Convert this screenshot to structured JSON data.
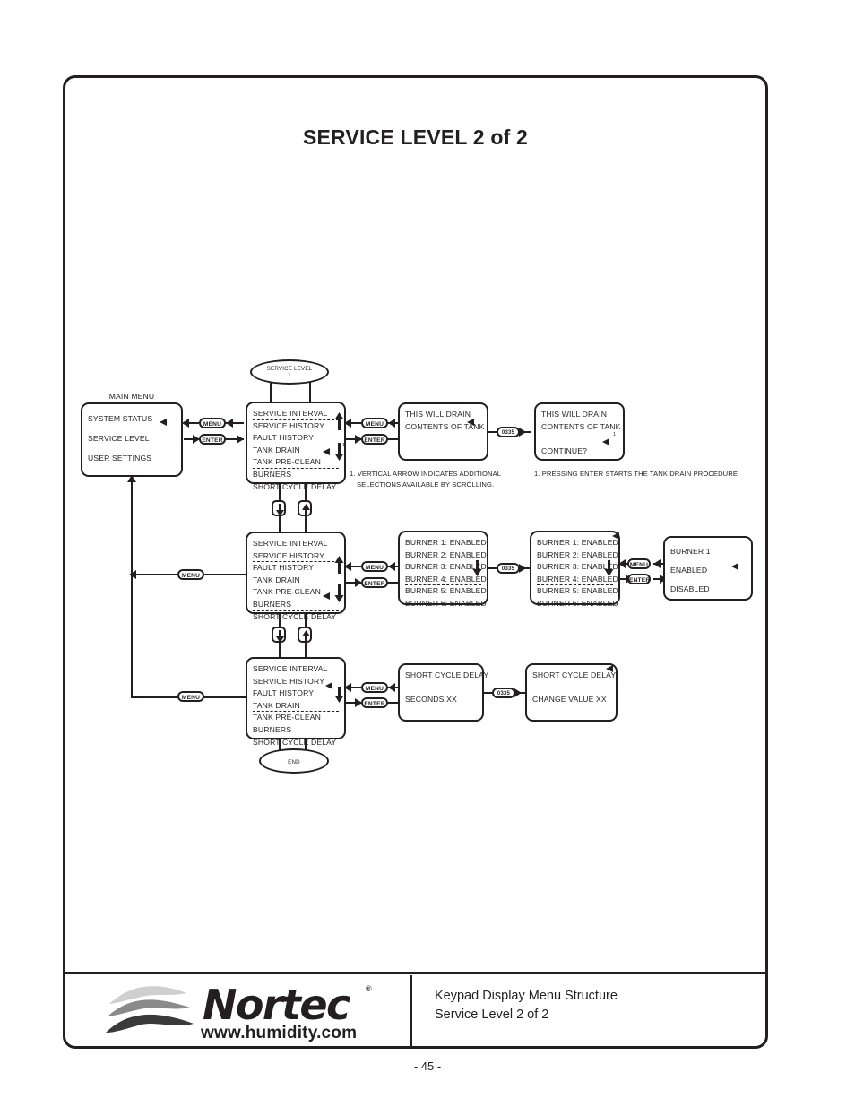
{
  "document": {
    "title": "SERVICE LEVEL 2 of 2",
    "page_number": "- 45 -"
  },
  "footer": {
    "logo_word": "Nortec",
    "logo_registered": "®",
    "logo_url": "www.humidity.com",
    "caption_line1": "Keypad Display Menu Structure",
    "caption_line2": "Service Level 2 of 2"
  },
  "buttons": {
    "menu": "MENU",
    "enter": "ENTER",
    "code": "0335",
    "arrow_down": "arrow-down",
    "arrow_up": "arrow-up"
  },
  "terminators": {
    "start_label": "SERVICE LEVEL",
    "start_sub": "1",
    "end_label": "END"
  },
  "main_menu": {
    "heading": "MAIN MENU",
    "items": [
      "SYSTEM STATUS",
      "SERVICE LEVEL",
      "USER SETTINGS"
    ]
  },
  "row1": {
    "menu_list": [
      "SERVICE INTERVAL",
      "SERVICE HISTORY",
      "FAULT HISTORY",
      "TANK DRAIN",
      "TANK PRE-CLEAN",
      "BURNERS",
      "SHORT CYCLE DELAY"
    ],
    "screen_a": [
      "THIS WILL DRAIN",
      "CONTENTS OF TANK"
    ],
    "screen_b": [
      "THIS WILL DRAIN",
      "CONTENTS OF TANK",
      "",
      "CONTINUE?"
    ],
    "note": "1. VERTICAL ARROW INDICATES ADDITIONAL SELECTIONS AVAILABLE BY SCROLLING.",
    "note_line1": "1. VERTICAL ARROW INDICATES ADDITIONAL",
    "note_line2": "SELECTIONS AVAILABLE BY SCROLLING.",
    "note_right": "1. PRESSING ENTER STARTS THE TANK DRAIN PROCEDURE"
  },
  "row2": {
    "menu_list": [
      "SERVICE INTERVAL",
      "SERVICE HISTORY",
      "FAULT HISTORY",
      "TANK DRAIN",
      "TANK PRE-CLEAN",
      "BURNERS",
      "SHORT CYCLE DELAY"
    ],
    "screen_a": [
      "BURNER 1: ENABLED",
      "BURNER 2: ENABLED",
      "BURNER 3: ENABLED",
      "BURNER 4: ENABLED",
      "BURNER 5: ENABLED",
      "BURNER 6: ENABLED"
    ],
    "screen_b": [
      "BURNER 1: ENABLED",
      "BURNER 2: ENABLED",
      "BURNER 3: ENABLED",
      "BURNER 4: ENABLED",
      "BURNER 5: ENABLED",
      "BURNER 6: ENABLED"
    ],
    "screen_c": [
      "BURNER 1",
      "",
      "ENABLED",
      "",
      "DISABLED"
    ]
  },
  "row3": {
    "menu_list": [
      "SERVICE INTERVAL",
      "SERVICE HISTORY",
      "FAULT HISTORY",
      "TANK DRAIN",
      "TANK PRE-CLEAN",
      "BURNERS",
      "SHORT CYCLE DELAY"
    ],
    "screen_a": [
      "SHORT CYCLE DELAY",
      "",
      "SECONDS XX"
    ],
    "screen_b": [
      "SHORT CYCLE DELAY",
      "",
      "CHANGE VALUE    XX"
    ]
  },
  "colors": {
    "ink": "#231f20",
    "paper": "#ffffff",
    "logo_wave_light": "#cfcfcf",
    "logo_wave_mid": "#8a8a8a",
    "logo_wave_dark": "#3a3a3a"
  }
}
